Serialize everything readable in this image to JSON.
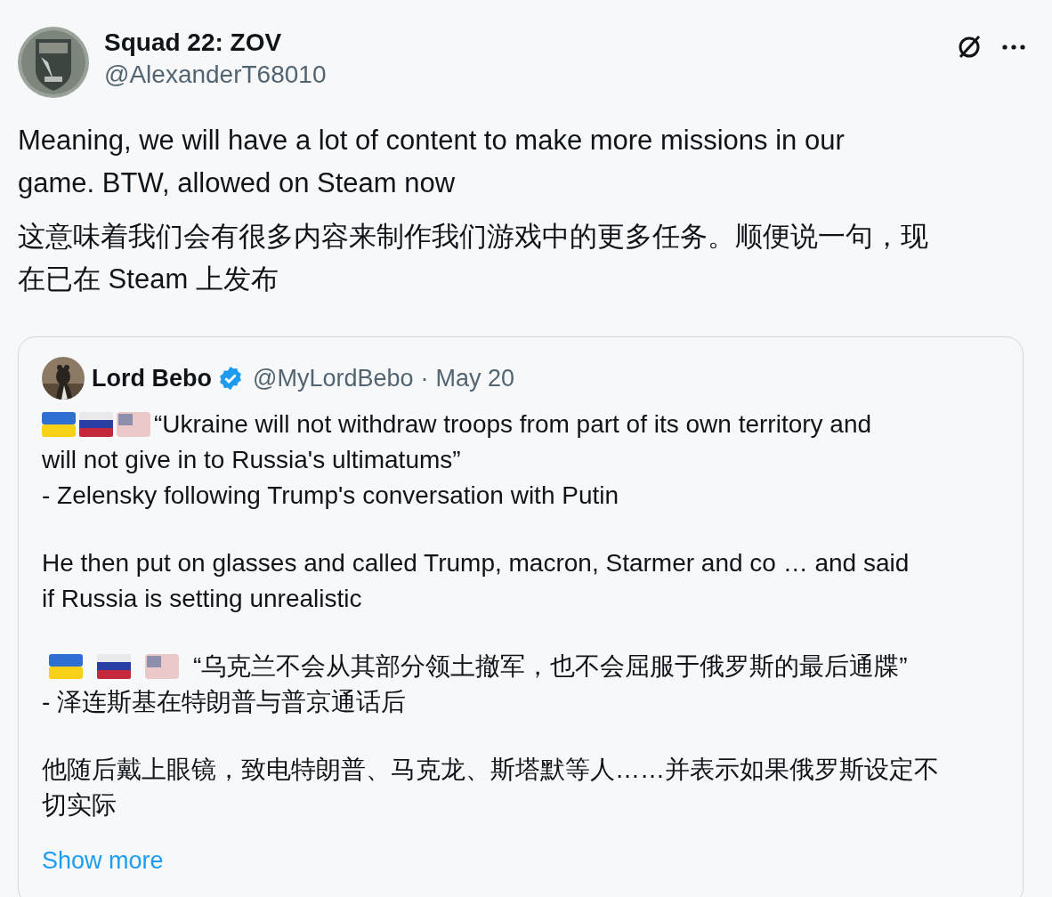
{
  "author": {
    "name": "Squad 22: ZOV",
    "handle": "@AlexanderT68010"
  },
  "text": [
    {
      "lines": [
        "Meaning, we will have a lot of content to make more missions in our",
        "game. BTW, allowed on Steam now"
      ]
    },
    {
      "lines": [
        "这意味着我们会有很多内容来制作我们游戏中的更多任务。顺便说一句，现",
        "在已在 Steam 上发布"
      ]
    }
  ],
  "quote": {
    "author": {
      "name": "Lord Bebo",
      "verified": true,
      "handle": "@MyLordBebo",
      "separator": "·",
      "date": "May 20"
    },
    "blocks": [
      {
        "kind": "flag_quote",
        "lines": [
          "“Ukraine will not withdraw troops from part of its own territory and",
          "will not give in to Russia's ultimatums”",
          " - Zelensky following Trump's conversation with Putin"
        ]
      },
      {
        "kind": "text",
        "lines": [
          "He then put on glasses and called Trump, macron, Starmer and co … and said",
          "if Russia is setting unrealistic"
        ]
      },
      {
        "kind": "flag_quote_spaced",
        "lines": [
          "“乌克兰不会从其部分领土撤军，也不会屈服于俄罗斯的最后通牒”",
          " - 泽连斯基在特朗普与普京通话后"
        ]
      },
      {
        "kind": "text",
        "lines": [
          "他随后戴上眼镜，致电特朗普、马克龙、斯塔默等人……并表示如果俄罗斯设定不",
          "切实际"
        ]
      }
    ],
    "show_more": "Show more"
  }
}
